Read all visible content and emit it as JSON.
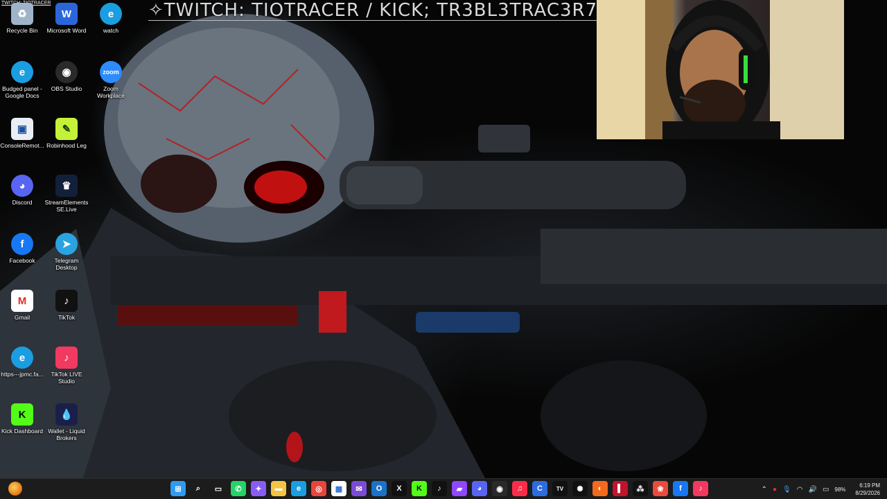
{
  "banner": {
    "caption": "TWITCH: TIOTRACER",
    "text": "✧TWITCH: TIOTRACER / KICK; TR3BL3TRAC3R7✧"
  },
  "desktop_icons": [
    {
      "label": "Recycle Bin",
      "icon": "recycle-bin-icon",
      "color": "#9fb4c8",
      "symbol": "♻"
    },
    {
      "label": "Microsoft Word",
      "icon": "word-icon",
      "color": "#2b66d9",
      "symbol": "W"
    },
    {
      "label": "watch",
      "icon": "edge-icon",
      "color": "#1b9de2",
      "symbol": "e"
    },
    {
      "label": "Budged panel - Google Docs",
      "icon": "edge-icon",
      "color": "#1b9de2",
      "symbol": "e"
    },
    {
      "label": "OBS Studio",
      "icon": "obs-icon",
      "color": "#2a2a2a",
      "symbol": "◉"
    },
    {
      "label": "Zoom Workplace",
      "icon": "zoom-icon",
      "color": "#2d8cff",
      "symbol": "zoom"
    },
    {
      "label": "ConsoleRemot...",
      "icon": "console-remote-icon",
      "color": "#e9eef5",
      "symbol": "▣"
    },
    {
      "label": "Robinhood Leg",
      "icon": "robinhood-icon",
      "color": "#c4f238",
      "symbol": "✎"
    },
    {
      "label": "Discord",
      "icon": "discord-icon",
      "color": "#5865f2",
      "symbol": "◕"
    },
    {
      "label": "StreamElements SE.Live",
      "icon": "streamelements-icon",
      "color": "#13203a",
      "symbol": "♛"
    },
    {
      "label": "Facebook",
      "icon": "facebook-icon",
      "color": "#1877f2",
      "symbol": "f"
    },
    {
      "label": "Telegram Desktop",
      "icon": "telegram-icon",
      "color": "#2aa3e0",
      "symbol": "➤"
    },
    {
      "label": "Gmail",
      "icon": "gmail-icon",
      "color": "#ffffff",
      "symbol": "M"
    },
    {
      "label": "TikTok",
      "icon": "tiktok-icon",
      "color": "#111111",
      "symbol": "♪"
    },
    {
      "label": "https---jpmc.fa...",
      "icon": "edge-icon",
      "color": "#1b9de2",
      "symbol": "e"
    },
    {
      "label": "TikTok LIVE Studio",
      "icon": "tiktok-live-icon",
      "color": "#f2395f",
      "symbol": "♪"
    },
    {
      "label": "Kick Dashboard",
      "icon": "kick-icon",
      "color": "#53fc18",
      "symbol": "K"
    },
    {
      "label": "Wallet - Liquid Brokers",
      "icon": "wallet-icon",
      "color": "#1a1f4a",
      "symbol": "💧"
    }
  ],
  "taskbar": {
    "apps": [
      {
        "icon": "windows-start-icon",
        "color": "#2f9bf0",
        "symbol": "⊞"
      },
      {
        "icon": "search-icon",
        "color": "#1c1c1c",
        "symbol": "⌕"
      },
      {
        "icon": "task-view-icon",
        "color": "#1c1c1c",
        "symbol": "▭"
      },
      {
        "icon": "whatsapp-icon",
        "color": "#25d366",
        "symbol": "✆"
      },
      {
        "icon": "copilot-icon",
        "color": "#8a5cf6",
        "symbol": "✦"
      },
      {
        "icon": "file-explorer-icon",
        "color": "#f4c542",
        "symbol": "▬"
      },
      {
        "icon": "edge-icon",
        "color": "#1b9de2",
        "symbol": "e"
      },
      {
        "icon": "chrome-icon",
        "color": "#e8453c",
        "symbol": "◎"
      },
      {
        "icon": "store-icon",
        "color": "#ffffff",
        "symbol": "▦"
      },
      {
        "icon": "mail-icon",
        "color": "#7b4bd6",
        "symbol": "✉"
      },
      {
        "icon": "outlook-icon",
        "color": "#1a73c8",
        "symbol": "O"
      },
      {
        "icon": "x-icon",
        "color": "#111111",
        "symbol": "X"
      },
      {
        "icon": "kick-icon",
        "color": "#53fc18",
        "symbol": "K"
      },
      {
        "icon": "tiktok-icon",
        "color": "#111111",
        "symbol": "♪"
      },
      {
        "icon": "twitch-icon",
        "color": "#9146ff",
        "symbol": "▰"
      },
      {
        "icon": "discord-icon",
        "color": "#5865f2",
        "symbol": "◕"
      },
      {
        "icon": "obs-icon",
        "color": "#2a2a2a",
        "symbol": "◉"
      },
      {
        "icon": "music-icon",
        "color": "#fa2d48",
        "symbol": "♫"
      },
      {
        "icon": "chrome-remote-icon",
        "color": "#2d6cdf",
        "symbol": "C"
      },
      {
        "icon": "tradingview-icon",
        "color": "#111111",
        "symbol": "TV"
      },
      {
        "icon": "chatgpt-icon",
        "color": "#111111",
        "symbol": "✺"
      },
      {
        "icon": "app-orange-icon",
        "color": "#f26b1d",
        "symbol": "◐"
      },
      {
        "icon": "app-red-icon",
        "color": "#c0142c",
        "symbol": "▌"
      },
      {
        "icon": "app-grid-icon",
        "color": "#111111",
        "symbol": "⁂"
      },
      {
        "icon": "photos-icon",
        "color": "#e94b3c",
        "symbol": "❀"
      },
      {
        "icon": "facebook-icon",
        "color": "#1877f2",
        "symbol": "f"
      },
      {
        "icon": "tiktok-live-icon",
        "color": "#f2395f",
        "symbol": "♪"
      }
    ],
    "tray": {
      "battery": "98%",
      "time": "6:19 PM",
      "date": "8/29/2026"
    }
  }
}
